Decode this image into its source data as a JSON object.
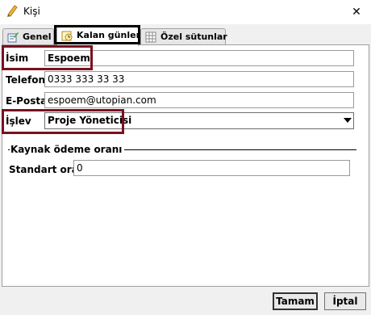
{
  "window": {
    "title": "Kişi",
    "close_glyph": "✕"
  },
  "tabs": [
    {
      "label": "Genel",
      "icon": "edit-form-icon"
    },
    {
      "label": "Kalan günler",
      "icon": "calendar-clock-icon"
    },
    {
      "label": "Özel sütunlar",
      "icon": "grid-table-icon"
    }
  ],
  "form": {
    "name_label": "İsim",
    "name_value": "Espoem",
    "phone_label": "Telefon",
    "phone_value": "0333 333 33 33",
    "email_label": "E-Posta",
    "email_value": "espoem@utopian.com",
    "role_label": "İşlev",
    "role_value": "Proje Yöneticisi"
  },
  "payment_group": {
    "caption": "Kaynak ödeme oranı",
    "rate_label": "Standart oran",
    "rate_value": "0"
  },
  "buttons": {
    "ok": "Tamam",
    "cancel": "İptal"
  },
  "colors": {
    "annotation_red": "#7a1020",
    "annotation_black": "#000000",
    "dialog_bg": "#f0f0f0"
  }
}
